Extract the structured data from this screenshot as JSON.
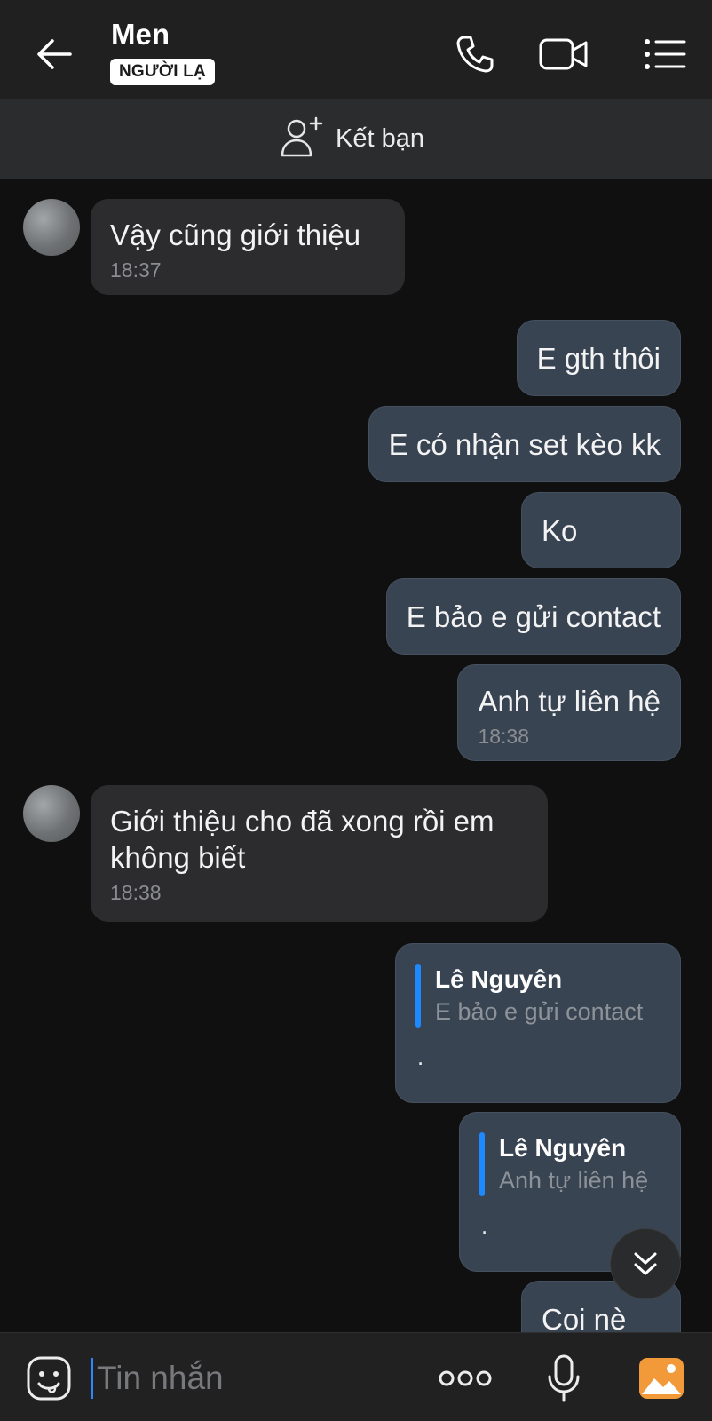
{
  "header": {
    "title": "Men",
    "badge": "NGƯỜI LẠ",
    "icons": [
      "back-arrow-icon",
      "phone-icon",
      "video-call-icon",
      "menu-list-icon"
    ]
  },
  "friend_bar": {
    "label": "Kết bạn",
    "icon": "add-friend-icon"
  },
  "messages": [
    {
      "side": "received",
      "text": "Vậy cũng giới thiệu",
      "time": "18:37"
    },
    {
      "side": "sent",
      "text": "E gth thôi"
    },
    {
      "side": "sent",
      "text": "E có nhận set kèo kk"
    },
    {
      "side": "sent",
      "text": "Ko"
    },
    {
      "side": "sent",
      "text": "E bảo e gửi contact"
    },
    {
      "side": "sent",
      "text": "Anh tự liên hệ",
      "time": "18:38"
    },
    {
      "side": "received",
      "text": "Giới thiệu cho đã xong rồi em\nkhông biết",
      "time": "18:38"
    },
    {
      "side": "sent",
      "quote_name": "Lê Nguyên",
      "quote_text": "E bảo e gửi contact",
      "text": "."
    },
    {
      "side": "sent",
      "quote_name": "Lê Nguyên",
      "quote_text": "Anh tự liên hệ",
      "text": "."
    },
    {
      "side": "sent",
      "text": "Coi nè"
    }
  ],
  "input_bar": {
    "placeholder": "Tin nhắn",
    "icons": [
      "sticker-icon",
      "more-dots-icon",
      "microphone-icon",
      "image-gallery-icon"
    ]
  },
  "colors": {
    "background": "#101010",
    "header": "#202020",
    "received_bubble": "#2c2c2e",
    "sent_bubble": "#394453",
    "accent": "#1e88ff",
    "gallery_icon": "#f29a3a"
  }
}
